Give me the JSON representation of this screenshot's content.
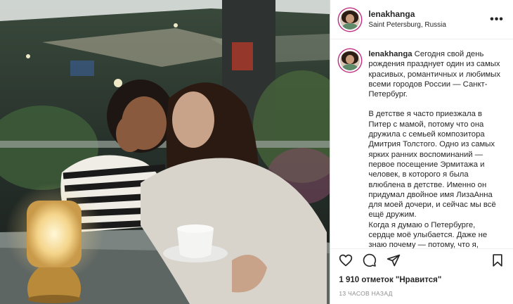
{
  "post": {
    "username": "lenakhanga",
    "location": "Saint Petersburg, Russia",
    "more_icon": "more-horizontal-icon",
    "caption_paragraphs": [
      "Сегодня свой день рождения празднует один из самых красивых, романтичных и любимых всеми городов России — Санкт-Петербург.",
      "В детстве я часто приезжала в Питер с мамой, потому что она дружила с семьей композитора Дмитрия Толстого. Одно из самых ярких ранних воспоминаний — первое посещение Эрмитажа и человек, в которого я была влюблена в детстве. Именно он придумал двойное имя ЛизаАнна для моей дочери, и сейчас мы всё ещё дружим.",
      "Когда я думаю о Петербурге, сердце моё улыбается. Даже не знаю почему — потому, что я, правда,"
    ],
    "likes": "1 910 отметок \"Нравится\"",
    "time": "13 часов назад",
    "icons": [
      "heart-icon",
      "comment-icon",
      "share-icon",
      "bookmark-icon"
    ]
  }
}
